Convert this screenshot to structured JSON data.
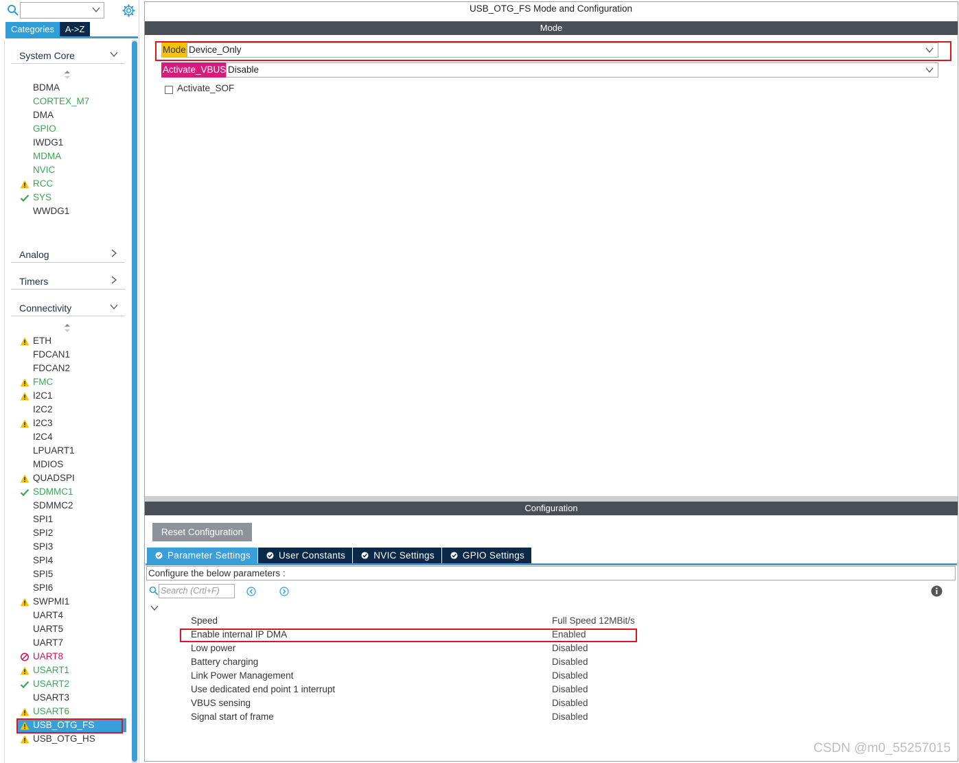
{
  "left": {
    "tabs": {
      "categories": "Categories",
      "az": "A->Z"
    },
    "system_core": {
      "title": "System Core",
      "items": [
        {
          "label": "BDMA",
          "color": "black",
          "icon": ""
        },
        {
          "label": "CORTEX_M7",
          "color": "green",
          "icon": ""
        },
        {
          "label": "DMA",
          "color": "black",
          "icon": ""
        },
        {
          "label": "GPIO",
          "color": "green",
          "icon": ""
        },
        {
          "label": "IWDG1",
          "color": "black",
          "icon": ""
        },
        {
          "label": "MDMA",
          "color": "green",
          "icon": ""
        },
        {
          "label": "NVIC",
          "color": "green",
          "icon": ""
        },
        {
          "label": "RCC",
          "color": "green",
          "icon": "warning"
        },
        {
          "label": "SYS",
          "color": "green",
          "icon": "check"
        },
        {
          "label": "WWDG1",
          "color": "black",
          "icon": ""
        }
      ]
    },
    "analog": {
      "title": "Analog"
    },
    "timers": {
      "title": "Timers"
    },
    "connectivity": {
      "title": "Connectivity",
      "items": [
        {
          "label": "ETH",
          "color": "black",
          "icon": "warning"
        },
        {
          "label": "FDCAN1",
          "color": "black",
          "icon": ""
        },
        {
          "label": "FDCAN2",
          "color": "black",
          "icon": ""
        },
        {
          "label": "FMC",
          "color": "green",
          "icon": "warning"
        },
        {
          "label": "I2C1",
          "color": "black",
          "icon": "warning"
        },
        {
          "label": "I2C2",
          "color": "black",
          "icon": ""
        },
        {
          "label": "I2C3",
          "color": "black",
          "icon": "warning"
        },
        {
          "label": "I2C4",
          "color": "black",
          "icon": ""
        },
        {
          "label": "LPUART1",
          "color": "black",
          "icon": ""
        },
        {
          "label": "MDIOS",
          "color": "black",
          "icon": ""
        },
        {
          "label": "QUADSPI",
          "color": "black",
          "icon": "warning"
        },
        {
          "label": "SDMMC1",
          "color": "green",
          "icon": "check"
        },
        {
          "label": "SDMMC2",
          "color": "black",
          "icon": ""
        },
        {
          "label": "SPI1",
          "color": "black",
          "icon": ""
        },
        {
          "label": "SPI2",
          "color": "black",
          "icon": ""
        },
        {
          "label": "SPI3",
          "color": "black",
          "icon": ""
        },
        {
          "label": "SPI4",
          "color": "black",
          "icon": ""
        },
        {
          "label": "SPI5",
          "color": "black",
          "icon": ""
        },
        {
          "label": "SPI6",
          "color": "black",
          "icon": ""
        },
        {
          "label": "SWPMI1",
          "color": "black",
          "icon": "warning"
        },
        {
          "label": "UART4",
          "color": "black",
          "icon": ""
        },
        {
          "label": "UART5",
          "color": "black",
          "icon": ""
        },
        {
          "label": "UART7",
          "color": "black",
          "icon": ""
        },
        {
          "label": "UART8",
          "color": "pink",
          "icon": "disabled"
        },
        {
          "label": "USART1",
          "color": "green",
          "icon": "warning"
        },
        {
          "label": "USART2",
          "color": "green",
          "icon": "check"
        },
        {
          "label": "USART3",
          "color": "black",
          "icon": ""
        },
        {
          "label": "USART6",
          "color": "green",
          "icon": "warning"
        },
        {
          "label": "USB_OTG_FS",
          "color": "white",
          "icon": "warning",
          "selected": true
        },
        {
          "label": "USB_OTG_HS",
          "color": "black",
          "icon": "warning"
        }
      ]
    }
  },
  "right": {
    "title": "USB_OTG_FS Mode and Configuration",
    "mode_section": "Mode",
    "mode_label": "Mode",
    "mode_value": "Device_Only",
    "vbus_label": "Activate_VBUS",
    "vbus_value": "Disable",
    "sof_label": "Activate_SOF",
    "config_section": "Configuration",
    "reset_button": "Reset Configuration",
    "tabs": [
      "Parameter Settings",
      "User Constants",
      "NVIC Settings",
      "GPIO Settings"
    ],
    "configure_text": "Configure the below parameters :",
    "search_placeholder": "Search (Crtl+F)",
    "params": [
      {
        "name": "Speed",
        "value": "Full Speed 12MBit/s"
      },
      {
        "name": "Enable internal IP DMA",
        "value": "Enabled"
      },
      {
        "name": "Low power",
        "value": "Disabled"
      },
      {
        "name": "Battery charging",
        "value": "Disabled"
      },
      {
        "name": "Link Power Management",
        "value": "Disabled"
      },
      {
        "name": "Use dedicated end point 1 interrupt",
        "value": "Disabled"
      },
      {
        "name": "VBUS sensing",
        "value": "Disabled"
      },
      {
        "name": "Signal start of frame",
        "value": "Disabled"
      }
    ]
  },
  "watermark": "CSDN @m0_55257015",
  "colors": {
    "accent": "#3a9fd8",
    "navy": "#0b2a4a",
    "green": "#3aa655",
    "warning": "#f5c400",
    "error": "#c2185b",
    "highlight": "#e0141e"
  }
}
